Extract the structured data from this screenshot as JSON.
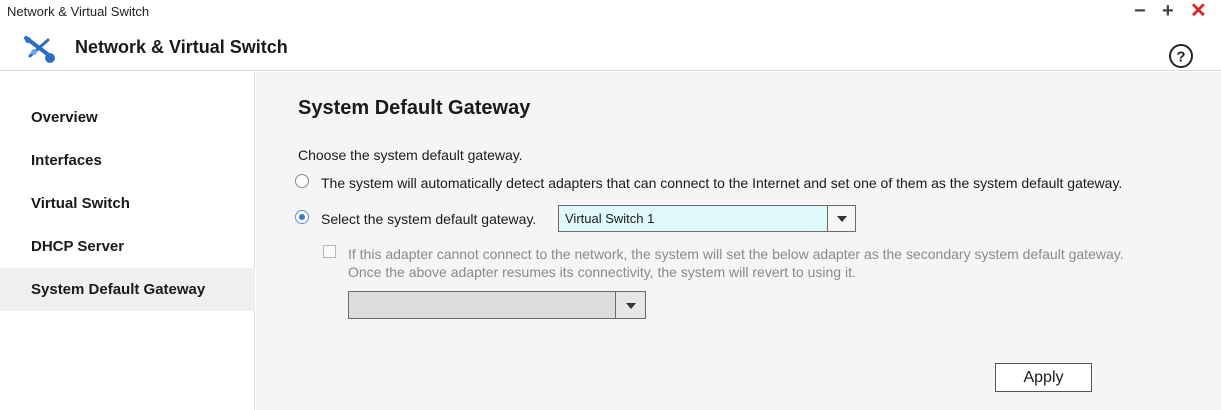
{
  "window": {
    "title": "Network & Virtual Switch",
    "controls": {
      "minimize": "−",
      "maximize": "+",
      "close": "✕"
    }
  },
  "header": {
    "app_title": "Network & Virtual Switch",
    "app_icon": "network-switch-icon",
    "help_icon": "help-circle-icon",
    "help_glyph": "?"
  },
  "sidebar": {
    "items": [
      {
        "label": "Overview"
      },
      {
        "label": "Interfaces"
      },
      {
        "label": "Virtual Switch"
      },
      {
        "label": "DHCP Server"
      },
      {
        "label": "System Default Gateway",
        "active": true
      }
    ]
  },
  "main": {
    "title": "System Default Gateway",
    "description": "Choose the system default gateway.",
    "options": [
      {
        "label": "The system will automatically detect adapters that can connect to the Internet and set one of them as the system default gateway.",
        "selected": false
      },
      {
        "label": "Select the system default gateway.",
        "selected": true
      }
    ],
    "gateway_select": {
      "value": "Virtual Switch 1"
    },
    "secondary": {
      "checked": false,
      "line1": "If this adapter cannot connect to the network, the system will set the below adapter as the secondary system default gateway.",
      "line2": "Once the above adapter resumes its connectivity, the system will revert to using it."
    },
    "secondary_select": {
      "value": ""
    },
    "apply_label": "Apply"
  },
  "colors": {
    "accent": "#3a78c9",
    "close": "#e02020",
    "select_highlight": "#dff8fa",
    "panel_bg": "#f5f5f5"
  }
}
